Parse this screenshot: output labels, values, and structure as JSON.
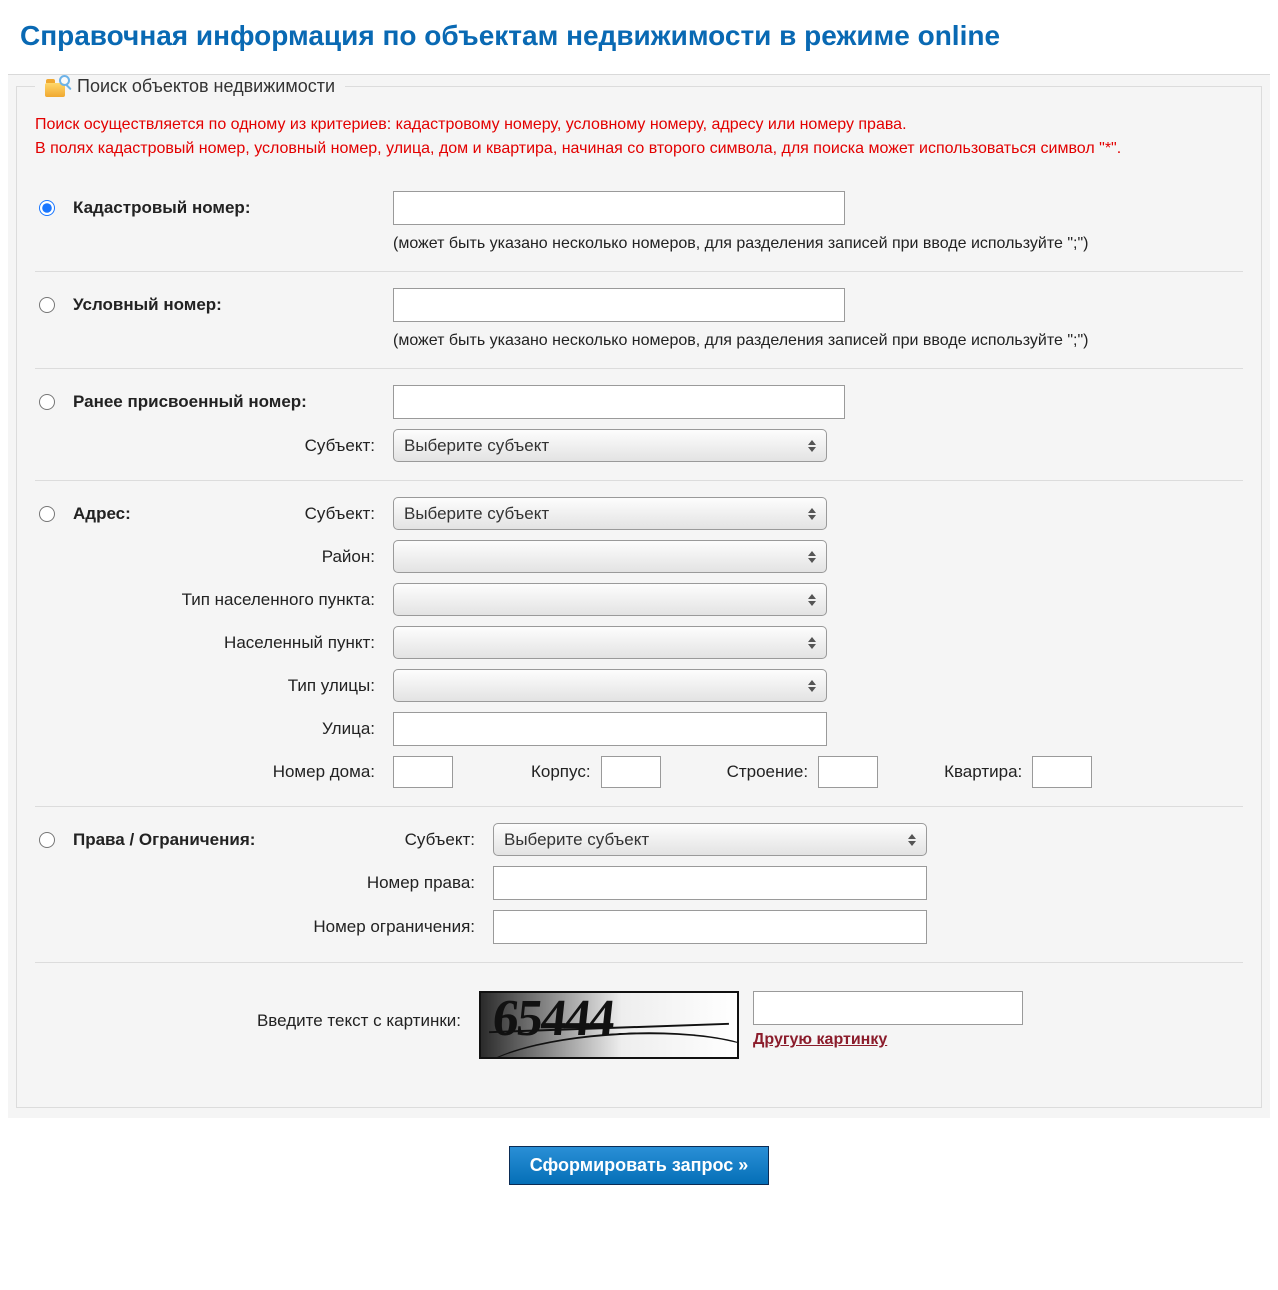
{
  "page": {
    "title": "Справочная информация по объектам недвижимости в режиме online"
  },
  "panel": {
    "legend": "Поиск объектов недвижимости"
  },
  "hint": {
    "line1": "Поиск осуществляется по одному из критериев: кадастровому номеру, условному номеру, адресу или номеру права.",
    "line2": "В полях кадастровый номер, условный номер, улица, дом и квартира, начиная со второго символа, для поиска может использоваться символ \"*\"."
  },
  "sections": {
    "cadastral": {
      "label": "Кадастровый номер:",
      "value": "",
      "sub_hint": "(может быть указано несколько номеров, для разделения записей при вводе используйте \";\")"
    },
    "conditional": {
      "label": "Условный номер:",
      "value": "",
      "sub_hint": "(может быть указано несколько номеров, для разделения записей при вводе используйте \";\")"
    },
    "previous": {
      "label": "Ранее присвоенный номер:",
      "value": "",
      "subject_label": "Субъект:",
      "subject_selected": "Выберите субъект"
    },
    "address": {
      "label": "Адрес:",
      "subject_label": "Субъект:",
      "subject_selected": "Выберите субъект",
      "district_label": "Район:",
      "district_selected": "",
      "settlement_type_label": "Тип населенного пункта:",
      "settlement_type_selected": "",
      "settlement_label": "Населенный пункт:",
      "settlement_selected": "",
      "street_type_label": "Тип улицы:",
      "street_type_selected": "",
      "street_label": "Улица:",
      "street_value": "",
      "house_label": "Номер дома:",
      "house_value": "",
      "korpus_label": "Корпус:",
      "korpus_value": "",
      "building_label": "Строение:",
      "building_value": "",
      "flat_label": "Квартира:",
      "flat_value": ""
    },
    "rights": {
      "label": "Права / Ограничения:",
      "subject_label": "Субъект:",
      "subject_selected": "Выберите субъект",
      "right_no_label": "Номер права:",
      "right_no_value": "",
      "restriction_no_label": "Номер ограничения:",
      "restriction_no_value": ""
    },
    "captcha": {
      "prompt": "Введите текст с картинки:",
      "image_text": "65444",
      "input_value": "",
      "other_link": "Другую картинку"
    }
  },
  "submit": {
    "label": "Сформировать запрос »"
  }
}
